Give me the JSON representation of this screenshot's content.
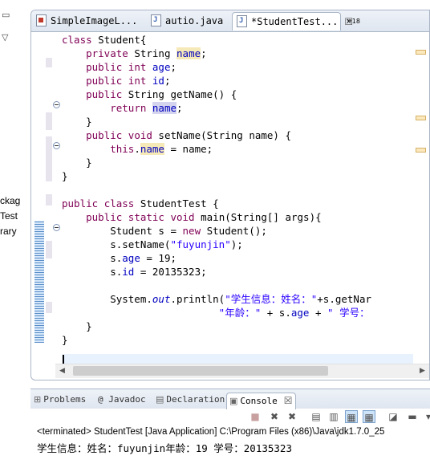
{
  "left_panel": {
    "items": [
      "ckag",
      "Test",
      "rary"
    ]
  },
  "editor": {
    "tabs": [
      {
        "label": "SimpleImageL..."
      },
      {
        "label": "autio.java"
      },
      {
        "label": "*StudentTest...",
        "close": "☒"
      }
    ],
    "overflow": {
      "symbol": "»",
      "count": "18"
    },
    "code": [
      [
        "class Student{"
      ],
      [
        "    private String name;"
      ],
      [
        "    public int age;"
      ],
      [
        "    public int id;"
      ],
      [
        "    public String getName() {"
      ],
      [
        "        return name;"
      ],
      [
        "    }"
      ],
      [
        "    public void setName(String name) {"
      ],
      [
        "        this.name = name;"
      ],
      [
        "    }"
      ],
      [
        "}"
      ],
      [
        ""
      ],
      [
        "public class StudentTest {"
      ],
      [
        "    public static void main(String[] args){"
      ],
      [
        "        Student s = new Student();"
      ],
      [
        "        s.setName(\"fuyunjin\");"
      ],
      [
        "        s.age = 19;"
      ],
      [
        "        s.id = 20135323;"
      ],
      [
        ""
      ],
      [
        "        System.out.println(\"学生信息：姓名：\"+s.getNar"
      ],
      [
        "                          \"年龄：\" + s.age + \" 学号："
      ],
      [
        "    }"
      ],
      [
        "}"
      ]
    ]
  },
  "console": {
    "tabs": [
      {
        "label": "Problems",
        "icon": "problems-icon"
      },
      {
        "label": "@ Javadoc",
        "icon": "javadoc-icon"
      },
      {
        "label": "Declaration",
        "icon": "declaration-icon"
      },
      {
        "label": "Console",
        "icon": "console-icon",
        "close": "☒"
      }
    ],
    "terminated": "<terminated> StudentTest [Java Application] C:\\Program Files (x86)\\Java\\jdk1.7.0_25",
    "output": "学生信息：姓名：fuyunjin年龄：19 学号：20135323"
  },
  "colors": {
    "keyword": "#7f0055",
    "field": "#0000c0",
    "string": "#2a00ff",
    "current_line": "#e8f2fe",
    "highlight": "#f6e9b8"
  }
}
